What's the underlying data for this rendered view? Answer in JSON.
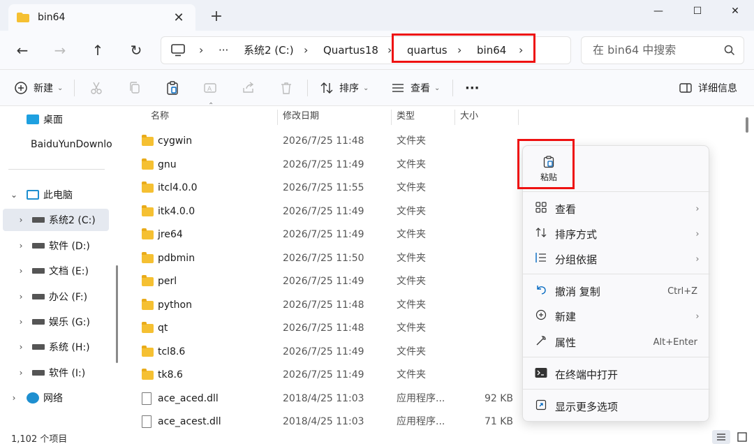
{
  "window": {
    "tab_title": "bin64",
    "tab_close": "✕",
    "new_tab": "+",
    "minimize": "—",
    "maximize": "☐",
    "close": "✕"
  },
  "nav": {
    "back": "←",
    "forward": "→",
    "up": "↑",
    "refresh": "↻",
    "breadcrumb": [
      "系统2 (C:)",
      "Quartus18",
      "quartus",
      "bin64"
    ],
    "more": "···",
    "search_placeholder": "在 bin64 中搜索"
  },
  "toolbar": {
    "new_label": "新建",
    "sort_label": "排序",
    "view_label": "查看",
    "more": "···",
    "details_label": "详细信息"
  },
  "sidebar": {
    "items": [
      {
        "label": "桌面"
      },
      {
        "label": "BaiduYunDownload"
      },
      {
        "label": "此电脑"
      },
      {
        "label": "系统2 (C:)"
      },
      {
        "label": "软件 (D:)"
      },
      {
        "label": "文档 (E:)"
      },
      {
        "label": "办公 (F:)"
      },
      {
        "label": "娱乐 (G:)"
      },
      {
        "label": "系统 (H:)"
      },
      {
        "label": "软件 (I:)"
      },
      {
        "label": "网络"
      }
    ]
  },
  "columns": {
    "name": "名称",
    "modified": "修改日期",
    "type": "类型",
    "size": "大小"
  },
  "files": [
    {
      "name": "cygwin",
      "date": "2026/7/25 11:48",
      "type": "文件夹",
      "size": ""
    },
    {
      "name": "gnu",
      "date": "2026/7/25 11:49",
      "type": "文件夹",
      "size": ""
    },
    {
      "name": "itcl4.0.0",
      "date": "2026/7/25 11:55",
      "type": "文件夹",
      "size": ""
    },
    {
      "name": "itk4.0.0",
      "date": "2026/7/25 11:49",
      "type": "文件夹",
      "size": ""
    },
    {
      "name": "jre64",
      "date": "2026/7/25 11:49",
      "type": "文件夹",
      "size": ""
    },
    {
      "name": "pdbmin",
      "date": "2026/7/25 11:50",
      "type": "文件夹",
      "size": ""
    },
    {
      "name": "perl",
      "date": "2026/7/25 11:49",
      "type": "文件夹",
      "size": ""
    },
    {
      "name": "python",
      "date": "2026/7/25 11:48",
      "type": "文件夹",
      "size": ""
    },
    {
      "name": "qt",
      "date": "2026/7/25 11:48",
      "type": "文件夹",
      "size": ""
    },
    {
      "name": "tcl8.6",
      "date": "2026/7/25 11:49",
      "type": "文件夹",
      "size": ""
    },
    {
      "name": "tk8.6",
      "date": "2026/7/25 11:49",
      "type": "文件夹",
      "size": ""
    },
    {
      "name": "ace_aced.dll",
      "date": "2018/4/25 11:03",
      "type": "应用程序...",
      "size": "92 KB"
    },
    {
      "name": "ace_acest.dll",
      "date": "2018/4/25 11:03",
      "type": "应用程序...",
      "size": "71 KB"
    }
  ],
  "status": {
    "count": "1,102 个项目"
  },
  "context_menu": {
    "paste": "粘贴",
    "view": "查看",
    "sort_by": "排序方式",
    "group_by": "分组依据",
    "undo": "撤消 复制",
    "undo_shortcut": "Ctrl+Z",
    "new": "新建",
    "properties": "属性",
    "properties_shortcut": "Alt+Enter",
    "open_terminal": "在终端中打开",
    "more_options": "显示更多选项",
    "arrow": "›"
  },
  "colors": {
    "highlight_box": "#e11111",
    "folder": "#f5c032",
    "accent": "#0067c0"
  }
}
